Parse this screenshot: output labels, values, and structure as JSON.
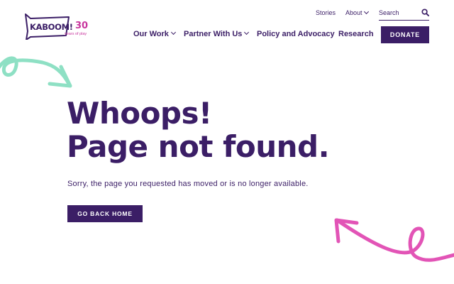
{
  "brand": {
    "wordmark": "KABOOM!",
    "anniversary": "30",
    "tagline": "years of play",
    "accent_color": "#c8369e",
    "primary_color": "#3b1e66"
  },
  "utility_nav": {
    "stories": "Stories",
    "about": "About",
    "search_placeholder": "Search"
  },
  "main_nav": {
    "items": [
      "Our Work",
      "Partner With Us",
      "Policy and Advocacy",
      "Research"
    ],
    "donate": "DONATE"
  },
  "content": {
    "headline_line1": "Whoops!",
    "headline_line2": "Page not found.",
    "message": "Sorry, the page you requested has moved or is no longer available.",
    "button": "GO BACK HOME"
  },
  "decorations": {
    "left_arrow_color": "#8ee0c4",
    "right_arrow_color": "#e254b6"
  }
}
